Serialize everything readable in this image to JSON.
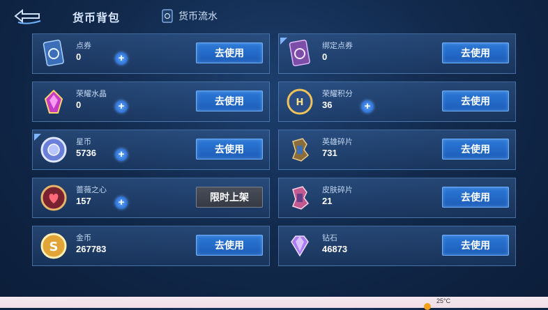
{
  "header": {
    "title": "货币背包",
    "flow_label": "货币流水",
    "back_icon": "back-arrow-icon",
    "flow_icon": "ledger-icon"
  },
  "cards": [
    {
      "name": "点券",
      "value": "0",
      "action": "去使用",
      "icon": "voucher-card-icon",
      "has_plus": true,
      "has_corner_hint": false
    },
    {
      "name": "绑定点券",
      "value": "0",
      "action": "去使用",
      "icon": "bound-voucher-card-icon",
      "has_plus": false,
      "has_corner_hint": true
    },
    {
      "name": "荣耀水晶",
      "value": "0",
      "action": "去使用",
      "icon": "glory-crystal-icon",
      "has_plus": true,
      "has_corner_hint": false
    },
    {
      "name": "荣耀积分",
      "value": "36",
      "action": "去使用",
      "icon": "glory-points-icon",
      "has_plus": true,
      "has_corner_hint": false
    },
    {
      "name": "星币",
      "value": "5736",
      "action": "去使用",
      "icon": "star-coin-icon",
      "has_plus": true,
      "has_corner_hint": true
    },
    {
      "name": "英雄碎片",
      "value": "731",
      "action": "去使用",
      "icon": "hero-fragment-icon",
      "has_plus": false,
      "has_corner_hint": false
    },
    {
      "name": "蔷薇之心",
      "value": "157",
      "action": "限时上架",
      "icon": "rose-heart-icon",
      "has_plus": true,
      "has_corner_hint": false,
      "action_disabled": true
    },
    {
      "name": "皮肤碎片",
      "value": "21",
      "action": "去使用",
      "icon": "skin-fragment-icon",
      "has_plus": false,
      "has_corner_hint": false
    },
    {
      "name": "金币",
      "value": "267783",
      "action": "去使用",
      "icon": "gold-coin-icon",
      "has_plus": false,
      "has_corner_hint": false
    },
    {
      "name": "钻石",
      "value": "46873",
      "action": "去使用",
      "icon": "diamond-icon",
      "has_plus": false,
      "has_corner_hint": false
    }
  ],
  "taskbar": {
    "temperature": "25°C",
    "weather_icon": "sun-icon"
  },
  "colors": {
    "accent_blue": "#2c78d6",
    "plus_blue": "#3f8ae8",
    "disabled_gray": "#3f434d"
  }
}
